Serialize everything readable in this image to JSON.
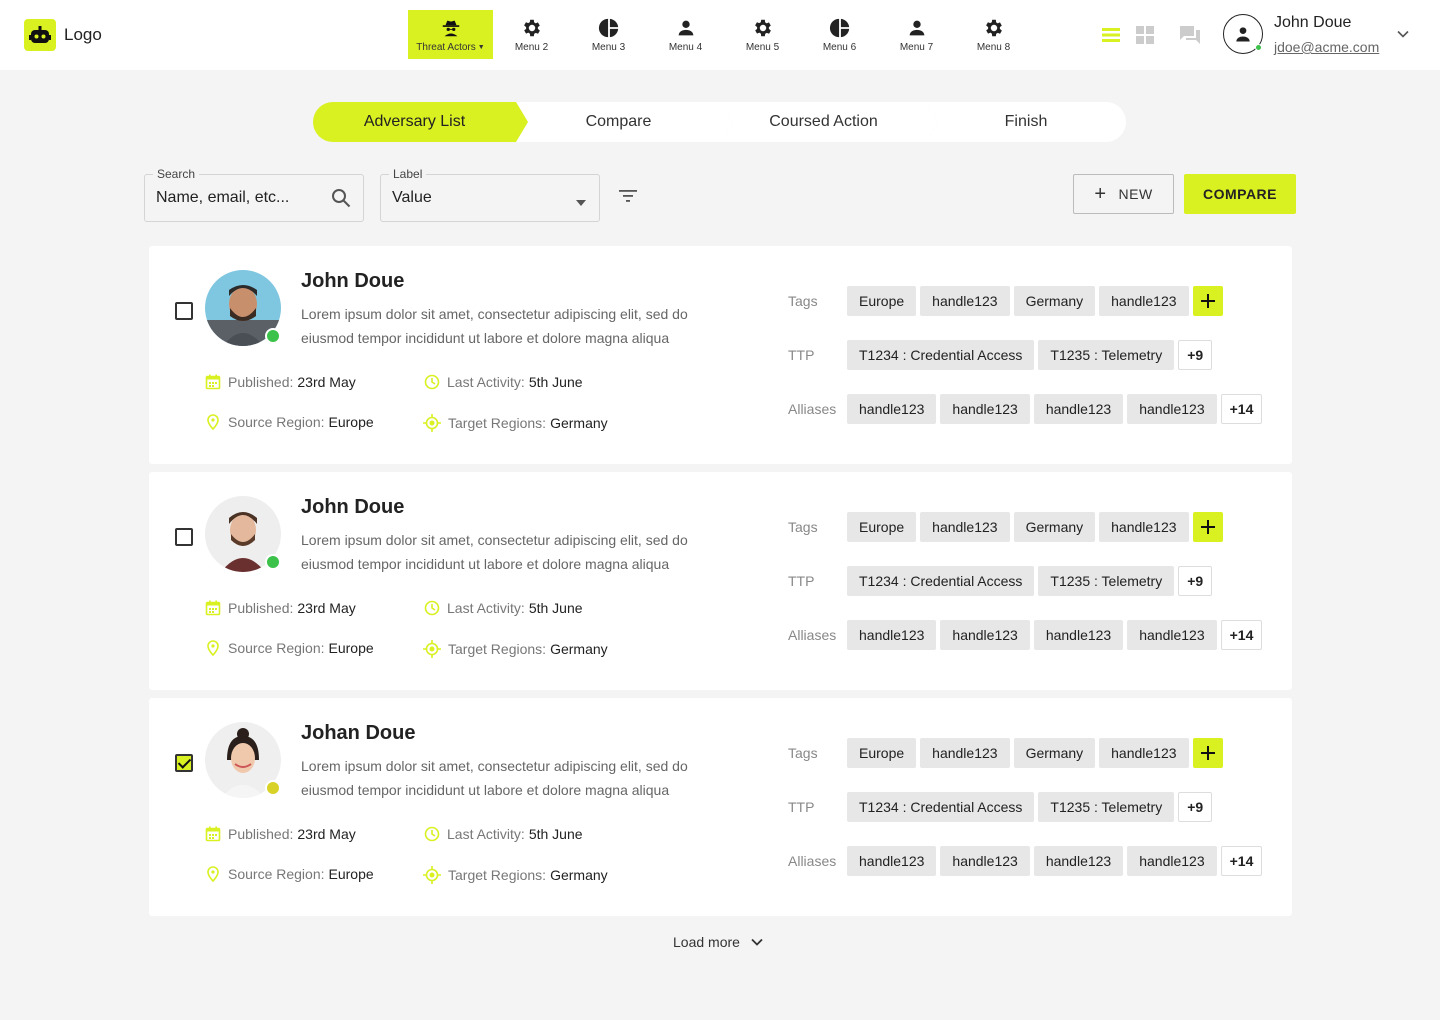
{
  "brand": {
    "logo_text": "Logo",
    "accent": "#d9f021"
  },
  "nav": [
    {
      "label": "Threat Actors",
      "icon": "spy-icon",
      "active": true
    },
    {
      "label": "Menu 2",
      "icon": "gear-icon"
    },
    {
      "label": "Menu 3",
      "icon": "pie-chart-icon"
    },
    {
      "label": "Menu 4",
      "icon": "person-icon"
    },
    {
      "label": "Menu 5",
      "icon": "gear-icon"
    },
    {
      "label": "Menu 6",
      "icon": "pie-chart-icon"
    },
    {
      "label": "Menu 7",
      "icon": "person-icon"
    },
    {
      "label": "Menu 8",
      "icon": "gear-icon"
    }
  ],
  "header_icons": [
    "list-view-icon",
    "grid-view-icon",
    "chat-icon"
  ],
  "user": {
    "name": "John Doue",
    "email": "jdoe@acme.com"
  },
  "stepper": [
    "Adversary List",
    "Compare",
    "Coursed Action",
    "Finish"
  ],
  "filters": {
    "search": {
      "label": "Search",
      "placeholder": "Name, email, etc..."
    },
    "label": {
      "label": "Label",
      "value": "Value"
    }
  },
  "buttons": {
    "new": "NEW",
    "compare": "COMPARE"
  },
  "cards": [
    {
      "name": "John Doue",
      "description": "Lorem ipsum dolor sit amet, consectetur adipiscing elit, sed do eiusmod tempor incididunt ut labore et dolore magna aliqua",
      "checked": false,
      "status": "online",
      "published_label": "Published:",
      "published": "23rd May",
      "activity_label": "Last Activity:",
      "activity": "5th June",
      "source_label": "Source Region:",
      "source": "Europe",
      "target_label": "Target Regions:",
      "target": "Germany",
      "tags_label": "Tags",
      "tags": [
        "Europe",
        "handle123",
        "Germany",
        "handle123"
      ],
      "ttp_label": "TTP",
      "ttp": [
        "T1234 : Credential Access",
        "T1235 : Telemetry"
      ],
      "ttp_more": "+9",
      "aliases_label": "Alliases",
      "aliases": [
        "handle123",
        "handle123",
        "handle123",
        "handle123"
      ],
      "aliases_more": "+14"
    },
    {
      "name": "John Doue",
      "description": "Lorem ipsum dolor sit amet, consectetur adipiscing elit, sed do eiusmod tempor incididunt ut labore et dolore magna aliqua",
      "checked": false,
      "status": "online",
      "published_label": "Published:",
      "published": "23rd May",
      "activity_label": "Last Activity:",
      "activity": "5th June",
      "source_label": "Source Region:",
      "source": "Europe",
      "target_label": "Target Regions:",
      "target": "Germany",
      "tags_label": "Tags",
      "tags": [
        "Europe",
        "handle123",
        "Germany",
        "handle123"
      ],
      "ttp_label": "TTP",
      "ttp": [
        "T1234 : Credential Access",
        "T1235 : Telemetry"
      ],
      "ttp_more": "+9",
      "aliases_label": "Alliases",
      "aliases": [
        "handle123",
        "handle123",
        "handle123",
        "handle123"
      ],
      "aliases_more": "+14"
    },
    {
      "name": "Johan Doue",
      "description": "Lorem ipsum dolor sit amet, consectetur adipiscing elit, sed do eiusmod tempor incididunt ut labore et dolore magna aliqua",
      "checked": true,
      "status": "away",
      "published_label": "Published:",
      "published": "23rd May",
      "activity_label": "Last Activity:",
      "activity": "5th June",
      "source_label": "Source Region:",
      "source": "Europe",
      "target_label": "Target Regions:",
      "target": "Germany",
      "tags_label": "Tags",
      "tags": [
        "Europe",
        "handle123",
        "Germany",
        "handle123"
      ],
      "ttp_label": "TTP",
      "ttp": [
        "T1234 : Credential Access",
        "T1235 : Telemetry"
      ],
      "ttp_more": "+9",
      "aliases_label": "Alliases",
      "aliases": [
        "handle123",
        "handle123",
        "handle123",
        "handle123"
      ],
      "aliases_more": "+14"
    }
  ],
  "load_more": "Load more"
}
